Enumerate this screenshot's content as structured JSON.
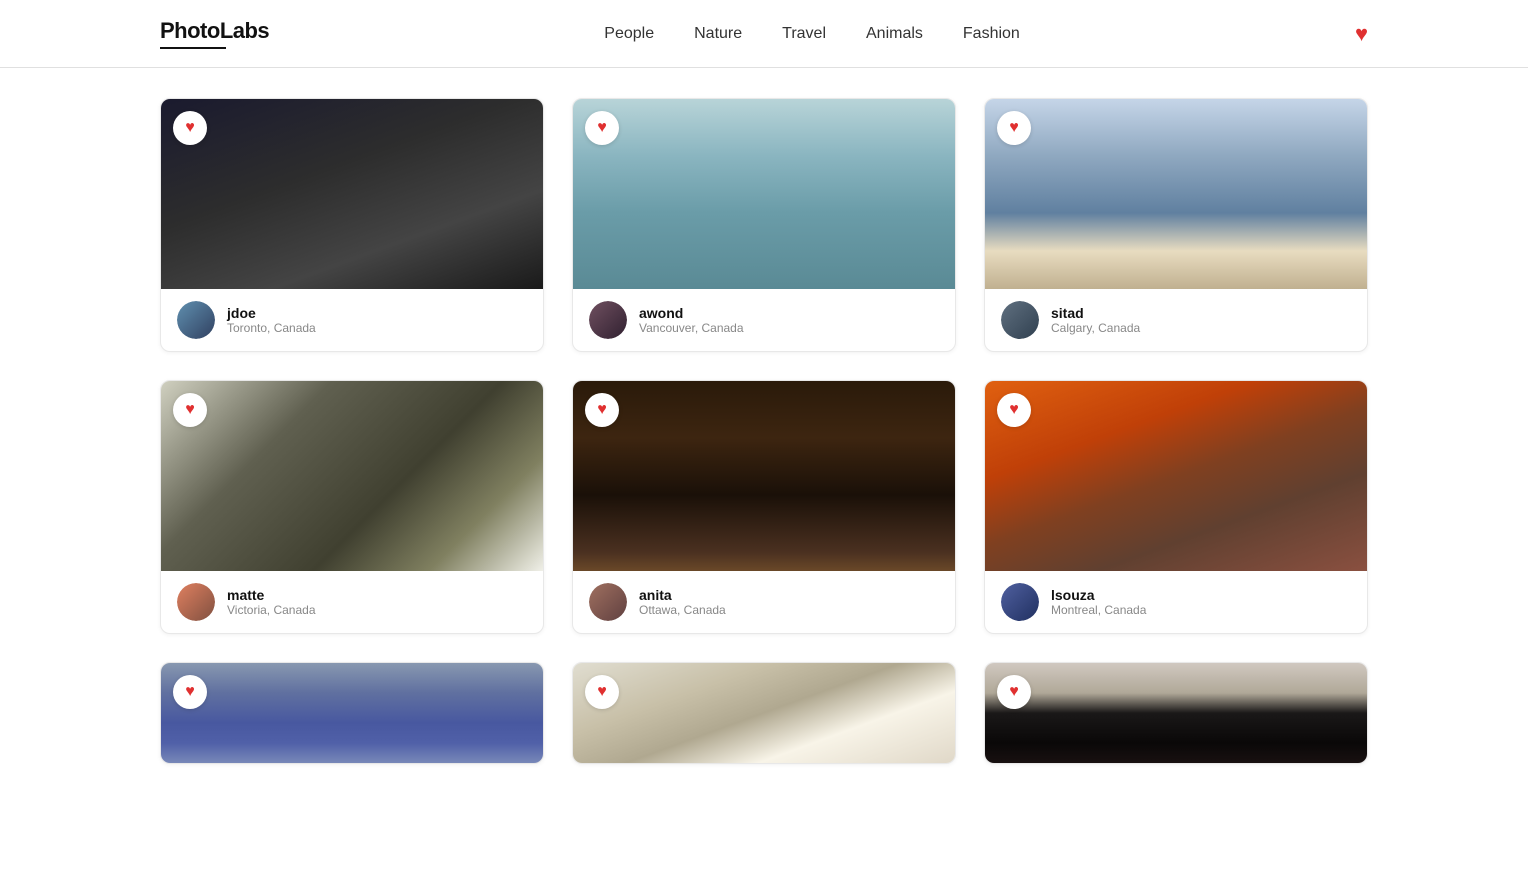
{
  "header": {
    "logo": "PhotoLabs",
    "nav": [
      {
        "label": "People",
        "id": "people"
      },
      {
        "label": "Nature",
        "id": "nature"
      },
      {
        "label": "Travel",
        "id": "travel"
      },
      {
        "label": "Animals",
        "id": "animals"
      },
      {
        "label": "Fashion",
        "id": "fashion"
      }
    ],
    "favorites_icon": "♥"
  },
  "cards": [
    {
      "id": "card-1",
      "username": "jdoe",
      "location": "Toronto, Canada",
      "image_class": "img-dark-man",
      "avatar_class": "av1"
    },
    {
      "id": "card-2",
      "username": "awond",
      "location": "Vancouver, Canada",
      "image_class": "img-woman-light",
      "avatar_class": "av2"
    },
    {
      "id": "card-3",
      "username": "sitad",
      "location": "Calgary, Canada",
      "image_class": "img-man-denim",
      "avatar_class": "av3"
    },
    {
      "id": "card-4",
      "username": "matte",
      "location": "Victoria, Canada",
      "image_class": "img-sandals",
      "avatar_class": "av4"
    },
    {
      "id": "card-5",
      "username": "anita",
      "location": "Ottawa, Canada",
      "image_class": "img-man-drink",
      "avatar_class": "av5"
    },
    {
      "id": "card-6",
      "username": "lsouza",
      "location": "Montreal, Canada",
      "image_class": "img-orange-fabric",
      "avatar_class": "av6"
    },
    {
      "id": "card-7",
      "username": "",
      "location": "",
      "image_class": "img-denim-person",
      "avatar_class": "av7",
      "partial": true
    },
    {
      "id": "card-8",
      "username": "",
      "location": "",
      "image_class": "img-sneaker",
      "avatar_class": "av8",
      "partial": true
    },
    {
      "id": "card-9",
      "username": "",
      "location": "",
      "image_class": "img-person-dark",
      "avatar_class": "av9",
      "partial": true
    }
  ],
  "heart_symbol": "♥"
}
